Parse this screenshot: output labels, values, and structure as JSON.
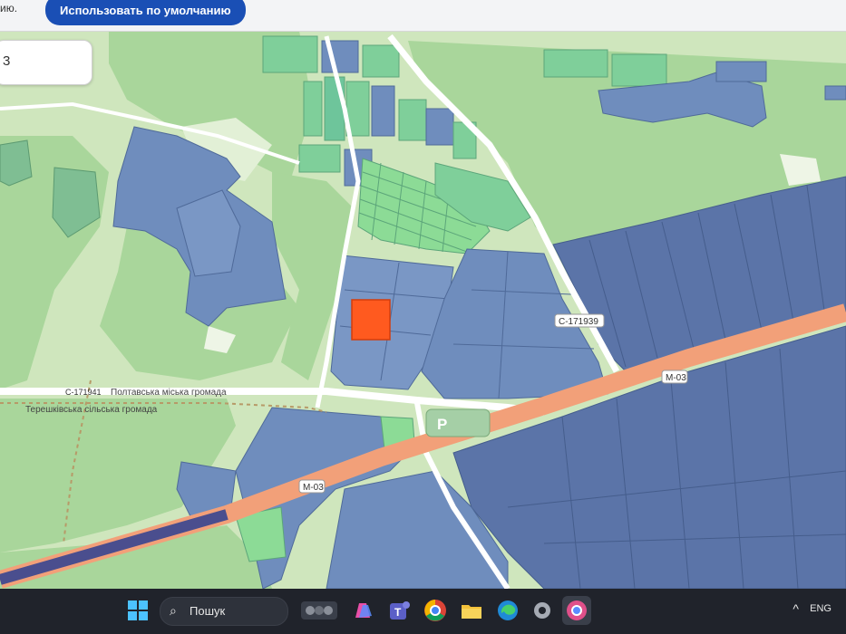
{
  "browser": {
    "partial_text": "ию.",
    "default_button": "Использовать по умолчанию"
  },
  "search": {
    "value": "3"
  },
  "map": {
    "road_labels": {
      "c171939": "C-171939",
      "m03_east": "M-03",
      "m03_west": "M-03",
      "c171941": "C-171941"
    },
    "boundary_labels": {
      "poltava": "Полтавська міська громада",
      "tereshky": "Терешківська сільська громада"
    },
    "parking_label": "P",
    "highlight_color": "#ff5a1f",
    "colors": {
      "forest": "#a7d49a",
      "meadow": "#cfe8bf",
      "parcel_blue": "#6f8dbd",
      "parcel_dark": "#5b74a8",
      "parcel_green": "#7fcf9a",
      "road_motorway": "#f2a079"
    }
  },
  "taskbar": {
    "search_label": "Пошук",
    "language": "ENG",
    "tray_chevron": "^",
    "icons": [
      "windows-start-icon",
      "search-icon",
      "media-icon",
      "copilot-icon",
      "teams-icon",
      "chrome-icon",
      "file-explorer-icon",
      "edge-icon",
      "settings-icon",
      "chrome-profile-icon"
    ]
  }
}
